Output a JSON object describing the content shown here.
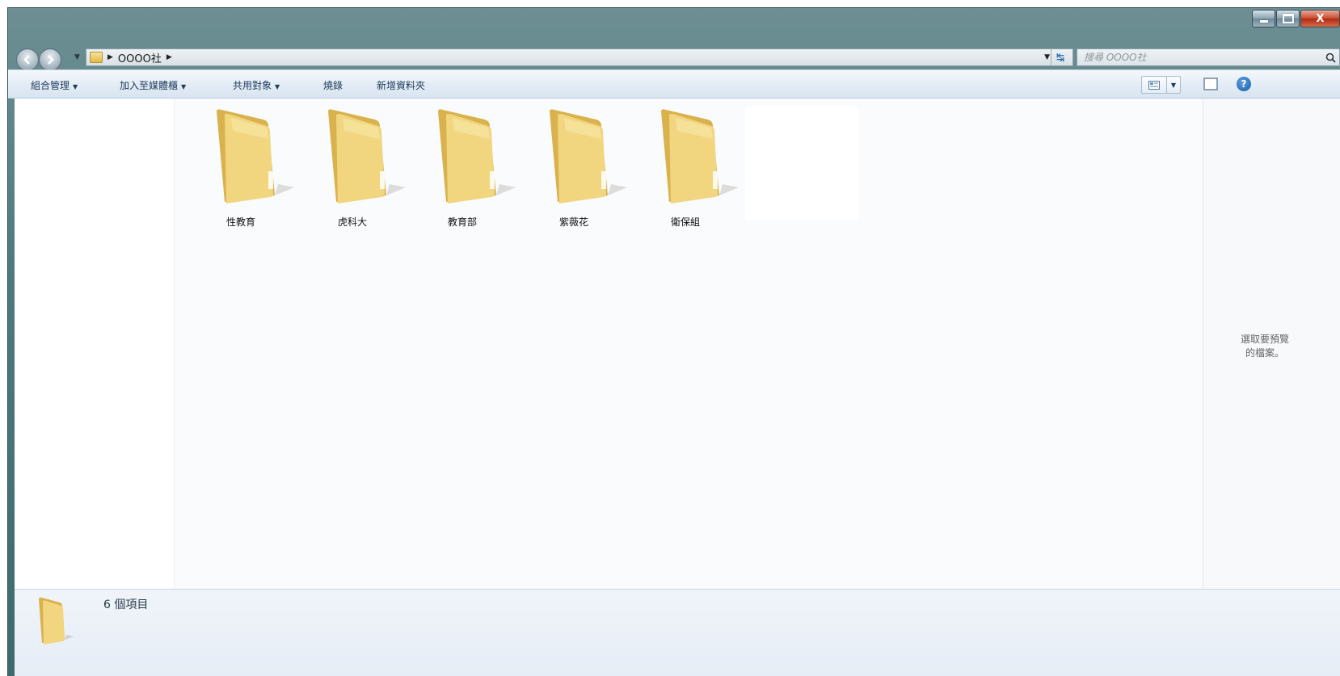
{
  "window": {
    "caption": {
      "close_label": "X"
    }
  },
  "address": {
    "path": [
      "OOOO社"
    ],
    "search_placeholder": "搜尋 OOOO社"
  },
  "toolbar": {
    "organize": "組合管理",
    "add_to_library": "加入至媒體櫃",
    "share_with": "共用對象",
    "burn": "燒錄",
    "new_folder": "新增資料夾"
  },
  "folders": [
    {
      "name": "性教育"
    },
    {
      "name": "虎科大"
    },
    {
      "name": "教育部"
    },
    {
      "name": "紫薇花"
    },
    {
      "name": "衛保組"
    }
  ],
  "preview": {
    "message_line1": "選取要預覽",
    "message_line2": "的檔案。"
  },
  "status": {
    "item_count": "6 個項目"
  },
  "icons": {
    "back": "back-arrow-icon",
    "forward": "forward-arrow-icon",
    "refresh": "refresh-icon",
    "search": "search-icon",
    "views": "views-icon",
    "preview_pane": "preview-pane-icon",
    "help": "help-icon",
    "folder": "folder-icon"
  },
  "colors": {
    "frame": "#4d7a7e",
    "command_text": "#1e395b",
    "folder_yellow": "#f0d27a"
  }
}
